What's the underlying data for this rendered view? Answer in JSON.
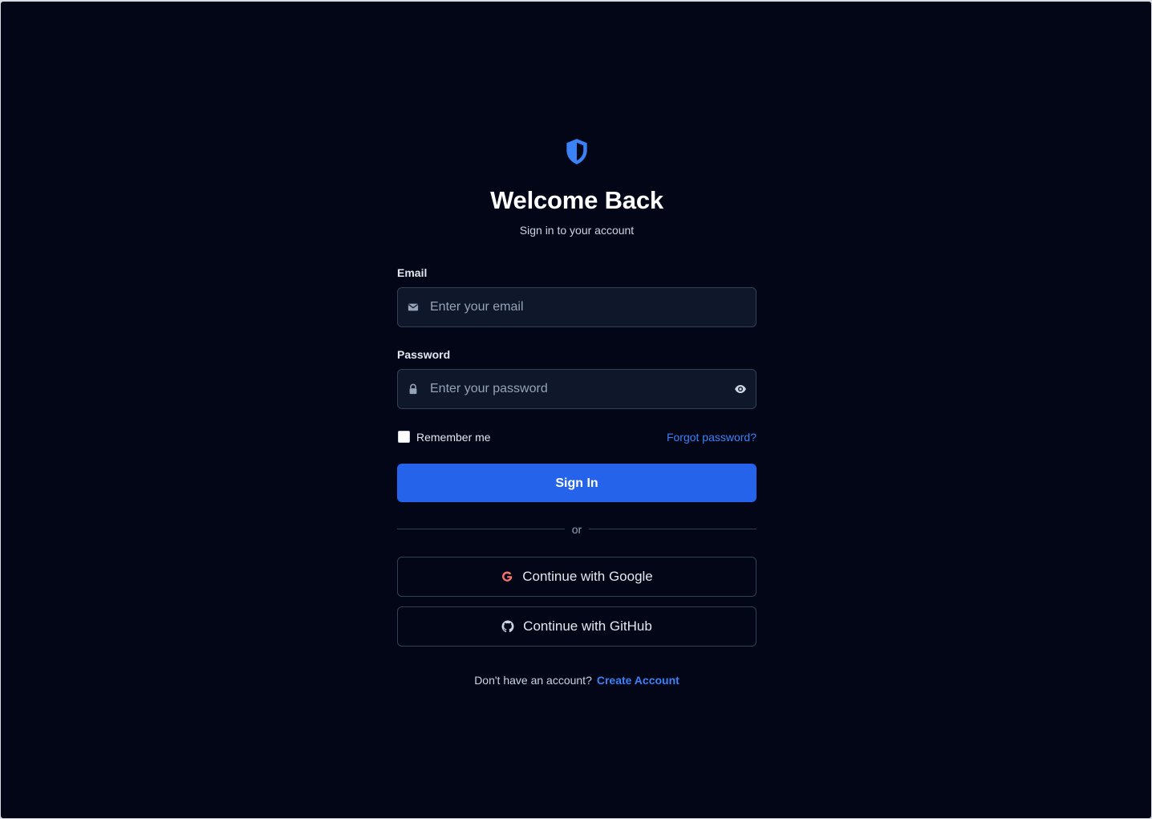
{
  "header": {
    "title": "Welcome Back",
    "subtitle": "Sign in to your account",
    "logo_icon": "shield-half-icon"
  },
  "form": {
    "email": {
      "label": "Email",
      "placeholder": "Enter your email",
      "value": "",
      "icon": "envelope-icon"
    },
    "password": {
      "label": "Password",
      "placeholder": "Enter your password",
      "value": "",
      "icon": "lock-icon",
      "toggle_icon": "eye-icon"
    },
    "remember_label": "Remember me",
    "remember_checked": false,
    "forgot_label": "Forgot password?",
    "submit_label": "Sign In"
  },
  "divider": {
    "label": "or"
  },
  "social": {
    "google_label": "Continue with Google",
    "google_icon": "google-icon",
    "github_label": "Continue with GitHub",
    "github_icon": "github-icon"
  },
  "footer": {
    "prompt": "Don't have an account?",
    "link_label": "Create Account"
  },
  "colors": {
    "background": "#020617",
    "accent": "#2563eb",
    "link": "#3b82f6",
    "input_bg": "#0f172a",
    "border": "#334155",
    "google_red": "#f87171"
  }
}
